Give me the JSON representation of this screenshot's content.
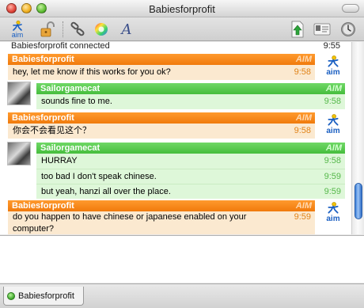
{
  "window": {
    "title": "Babiesforprofit"
  },
  "toolbar": {
    "service_label": "aim"
  },
  "status_line": {
    "text": "Babiesforprofit connected",
    "time": "9:55"
  },
  "service_tag": "AIM",
  "messages": [
    {
      "sender": "Babiesforprofit",
      "side": "orange",
      "lines": [
        {
          "text": "hey, let me know if this works for you ok?",
          "time": "9:58"
        }
      ]
    },
    {
      "sender": "Sailorgamecat",
      "side": "green",
      "lines": [
        {
          "text": "sounds fine to me.",
          "time": "9:58"
        }
      ]
    },
    {
      "sender": "Babiesforprofit",
      "side": "orange",
      "lines": [
        {
          "text": "你会不会看见这个？",
          "time": "9:58"
        }
      ]
    },
    {
      "sender": "Sailorgamecat",
      "side": "green",
      "lines": [
        {
          "text": "HURRAY",
          "time": "9:58"
        },
        {
          "text": "too bad I don't speak chinese.",
          "time": "9:59"
        },
        {
          "text": "but yeah, hanzi all over the place.",
          "time": "9:59"
        }
      ]
    },
    {
      "sender": "Babiesforprofit",
      "side": "orange",
      "lines": [
        {
          "text": "do you happen to have chinese or japanese enabled on your",
          "time": "9:59"
        },
        {
          "text": "computer?",
          "time": ""
        }
      ]
    }
  ],
  "tab": {
    "label": "Babiesforprofit"
  },
  "colors": {
    "orange": "#f07a0c",
    "green": "#45bd3c",
    "aim_blue": "#1a5fc2"
  }
}
